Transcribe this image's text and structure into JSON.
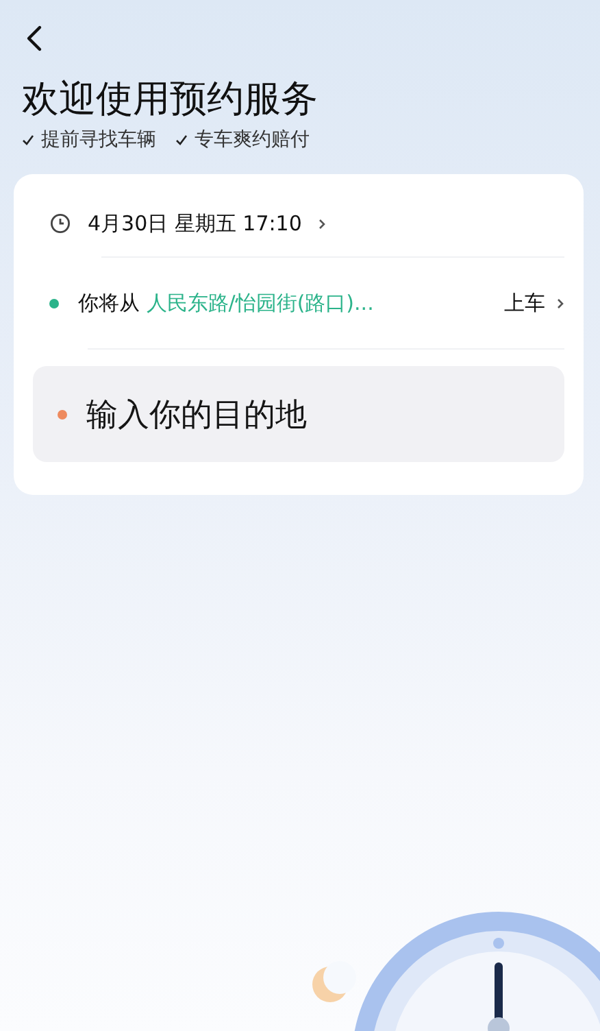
{
  "title": "欢迎使用预约服务",
  "features": [
    {
      "text": "提前寻找车辆"
    },
    {
      "text": "专车爽约赔付"
    }
  ],
  "card": {
    "time": "4月30日 星期五 17:10",
    "route": [
      {
        "kind": "pickup",
        "color": "#2bb38a",
        "prefix": "你将从",
        "place": "人民东路/怡园街(路口)...",
        "suffix": "上车"
      },
      {
        "kind": "destination",
        "color": "#ee8a5e",
        "label": "输入你的目的地"
      }
    ]
  }
}
